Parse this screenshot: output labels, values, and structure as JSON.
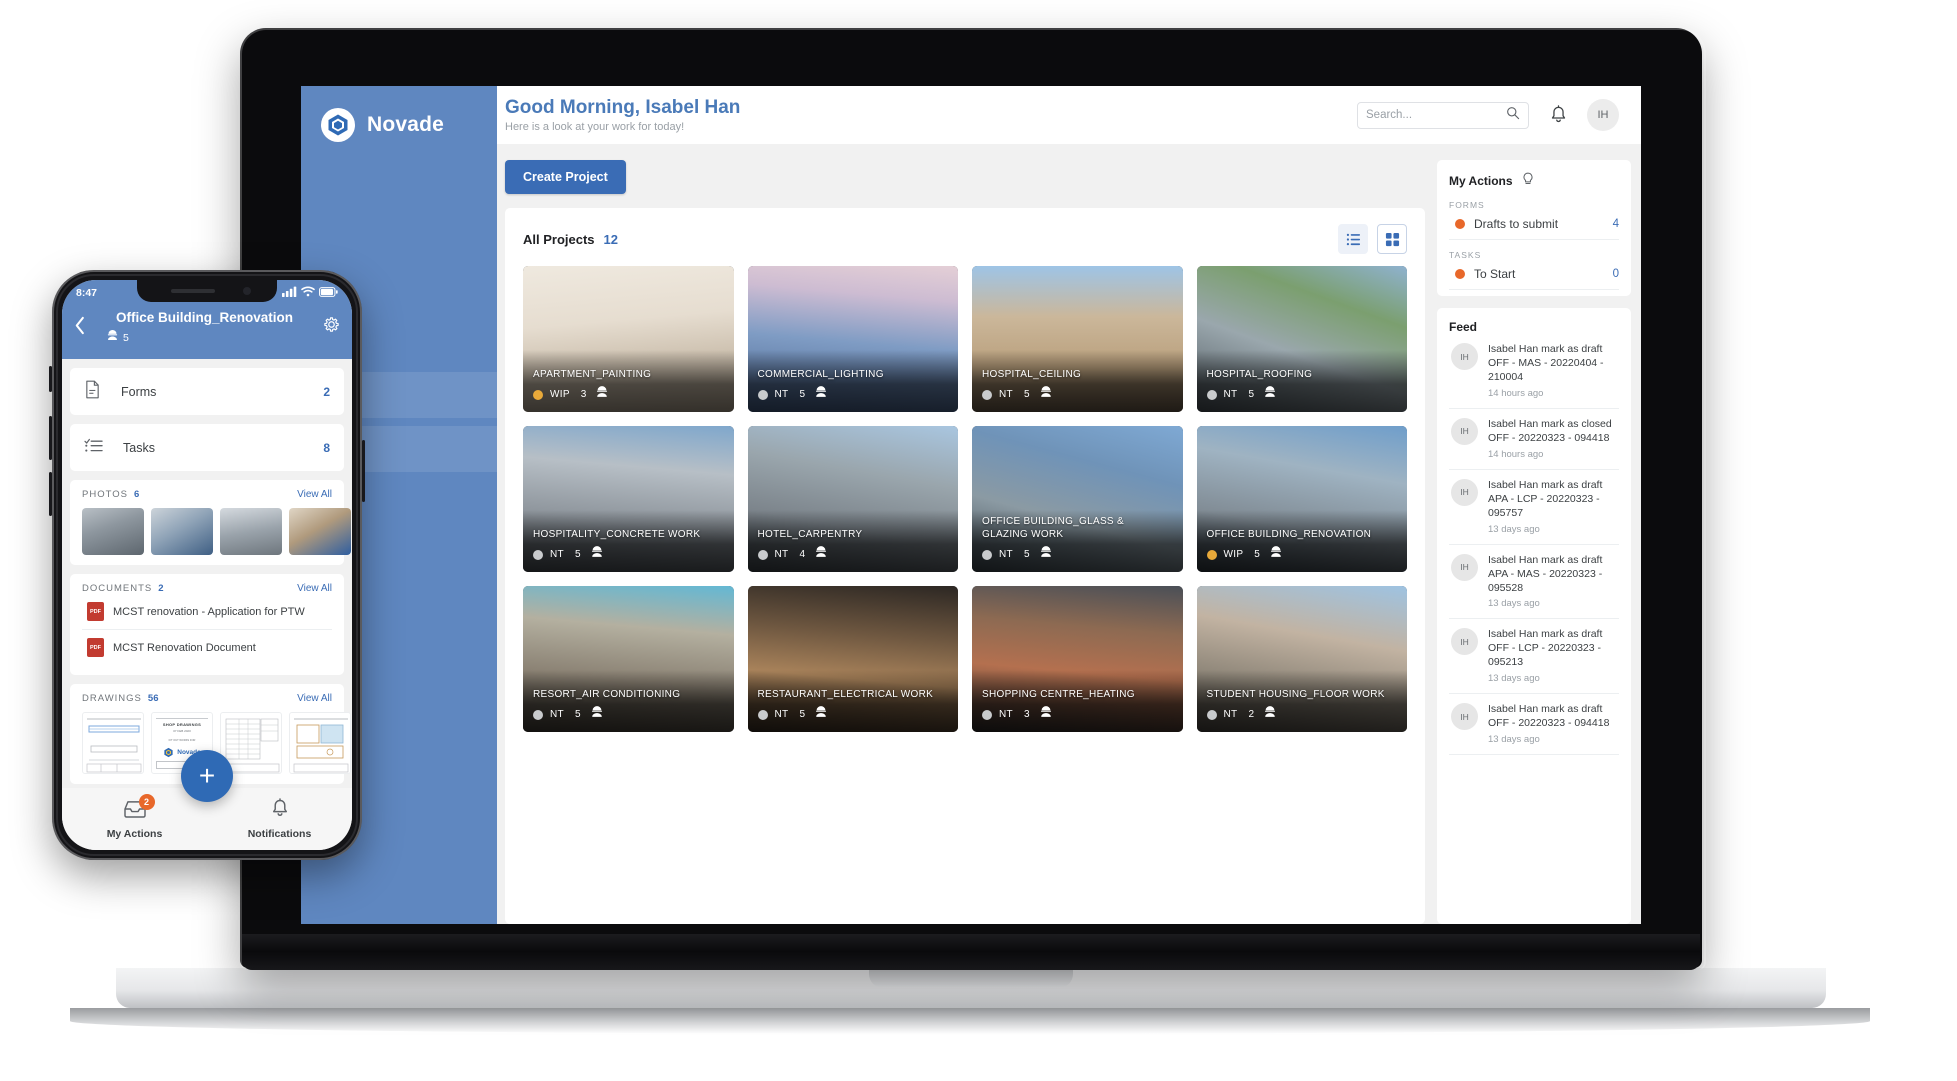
{
  "brand": {
    "name": "Novade"
  },
  "desktop": {
    "header": {
      "greeting_title": "Good Morning, Isabel Han",
      "greeting_subtitle": "Here is a look at your work for today!",
      "search_placeholder": "Search...",
      "search_value": "",
      "avatar_initials": "IH"
    },
    "create_button": "Create Project",
    "projects": {
      "title": "All Projects",
      "count": "12",
      "cards": [
        {
          "name": "APARTMENT_PAINTING",
          "status": "WIP",
          "status_color": "#e8a93a",
          "people": "3",
          "img": "apartment"
        },
        {
          "name": "COMMERCIAL_LIGHTING",
          "status": "NT",
          "status_color": "#c9cbcd",
          "people": "5",
          "img": "commercial"
        },
        {
          "name": "HOSPITAL_CEILING",
          "status": "NT",
          "status_color": "#c9cbcd",
          "people": "5",
          "img": "hospital"
        },
        {
          "name": "HOSPITAL_ROOFING",
          "status": "NT",
          "status_color": "#c9cbcd",
          "people": "5",
          "img": "roofing"
        },
        {
          "name": "HOSPITALITY_CONCRETE WORK",
          "status": "NT",
          "status_color": "#c9cbcd",
          "people": "5",
          "img": "hospitality"
        },
        {
          "name": "HOTEL_CARPENTRY",
          "status": "NT",
          "status_color": "#c9cbcd",
          "people": "4",
          "img": "hotel"
        },
        {
          "name": "OFFICE BUILDING_GLASS & GLAZING WORK",
          "status": "NT",
          "status_color": "#c9cbcd",
          "people": "5",
          "img": "glazing"
        },
        {
          "name": "OFFICE BUILDING_RENOVATION",
          "status": "WIP",
          "status_color": "#e8a93a",
          "people": "5",
          "img": "renovation"
        },
        {
          "name": "RESORT_AIR CONDITIONING",
          "status": "NT",
          "status_color": "#c9cbcd",
          "people": "5",
          "img": "resort"
        },
        {
          "name": "RESTAURANT_ELECTRICAL WORK",
          "status": "NT",
          "status_color": "#c9cbcd",
          "people": "5",
          "img": "restaurant"
        },
        {
          "name": "SHOPPING CENTRE_HEATING",
          "status": "NT",
          "status_color": "#c9cbcd",
          "people": "3",
          "img": "shopping"
        },
        {
          "name": "STUDENT HOUSING_FLOOR WORK",
          "status": "NT",
          "status_color": "#c9cbcd",
          "people": "2",
          "img": "student"
        }
      ]
    },
    "my_actions": {
      "title": "My Actions",
      "groups": [
        {
          "label": "FORMS",
          "items": [
            {
              "label": "Drafts to submit",
              "count": "4",
              "dot_color": "#e8682a"
            }
          ]
        },
        {
          "label": "TASKS",
          "items": [
            {
              "label": "To Start",
              "count": "0",
              "dot_color": "#e8682a"
            }
          ]
        }
      ]
    },
    "feed": {
      "title": "Feed",
      "items": [
        {
          "avatar": "IH",
          "text": "Isabel Han mark as draft OFF - MAS - 20220404 - 210004",
          "time": "14 hours ago"
        },
        {
          "avatar": "IH",
          "text": "Isabel Han mark as closed OFF - 20220323 - 094418",
          "time": "14 hours ago"
        },
        {
          "avatar": "IH",
          "text": "Isabel Han mark as draft APA - LCP - 20220323 - 095757",
          "time": "13 days ago"
        },
        {
          "avatar": "IH",
          "text": "Isabel Han mark as draft APA - MAS - 20220323 - 095528",
          "time": "13 days ago"
        },
        {
          "avatar": "IH",
          "text": "Isabel Han mark as draft OFF - LCP - 20220323 - 095213",
          "time": "13 days ago"
        },
        {
          "avatar": "IH",
          "text": "Isabel Han mark as draft OFF - 20220323 - 094418",
          "time": "13 days ago"
        }
      ]
    }
  },
  "phone": {
    "status_time": "8:47",
    "header": {
      "title": "Office Building_Renovation",
      "people_count": "5"
    },
    "rows": [
      {
        "label": "Forms",
        "count": "2",
        "icon": "document-icon"
      },
      {
        "label": "Tasks",
        "count": "8",
        "icon": "checklist-icon"
      }
    ],
    "photos": {
      "title": "PHOTOS",
      "count": "6",
      "view_all": "View All"
    },
    "documents": {
      "title": "DOCUMENTS",
      "count": "2",
      "view_all": "View All",
      "items": [
        {
          "badge": "PDF",
          "name": "MCST renovation - Application for PTW"
        },
        {
          "badge": "PDF",
          "name": "MCST Renovation Document"
        }
      ]
    },
    "drawings": {
      "title": "DRAWINGS",
      "count": "56",
      "view_all": "View All",
      "sheet_title": "SHOP DRAWINGS",
      "sheet_sub": "07 FEB 2020",
      "sheet_for": "FIT OUT WORKS FOR",
      "sheet_brand": "Novade"
    },
    "fab_label": "+",
    "tabs": [
      {
        "label": "My Actions",
        "icon": "inbox-icon",
        "badge": "2"
      },
      {
        "label": "Notifications",
        "icon": "bell-icon",
        "badge": ""
      }
    ]
  }
}
